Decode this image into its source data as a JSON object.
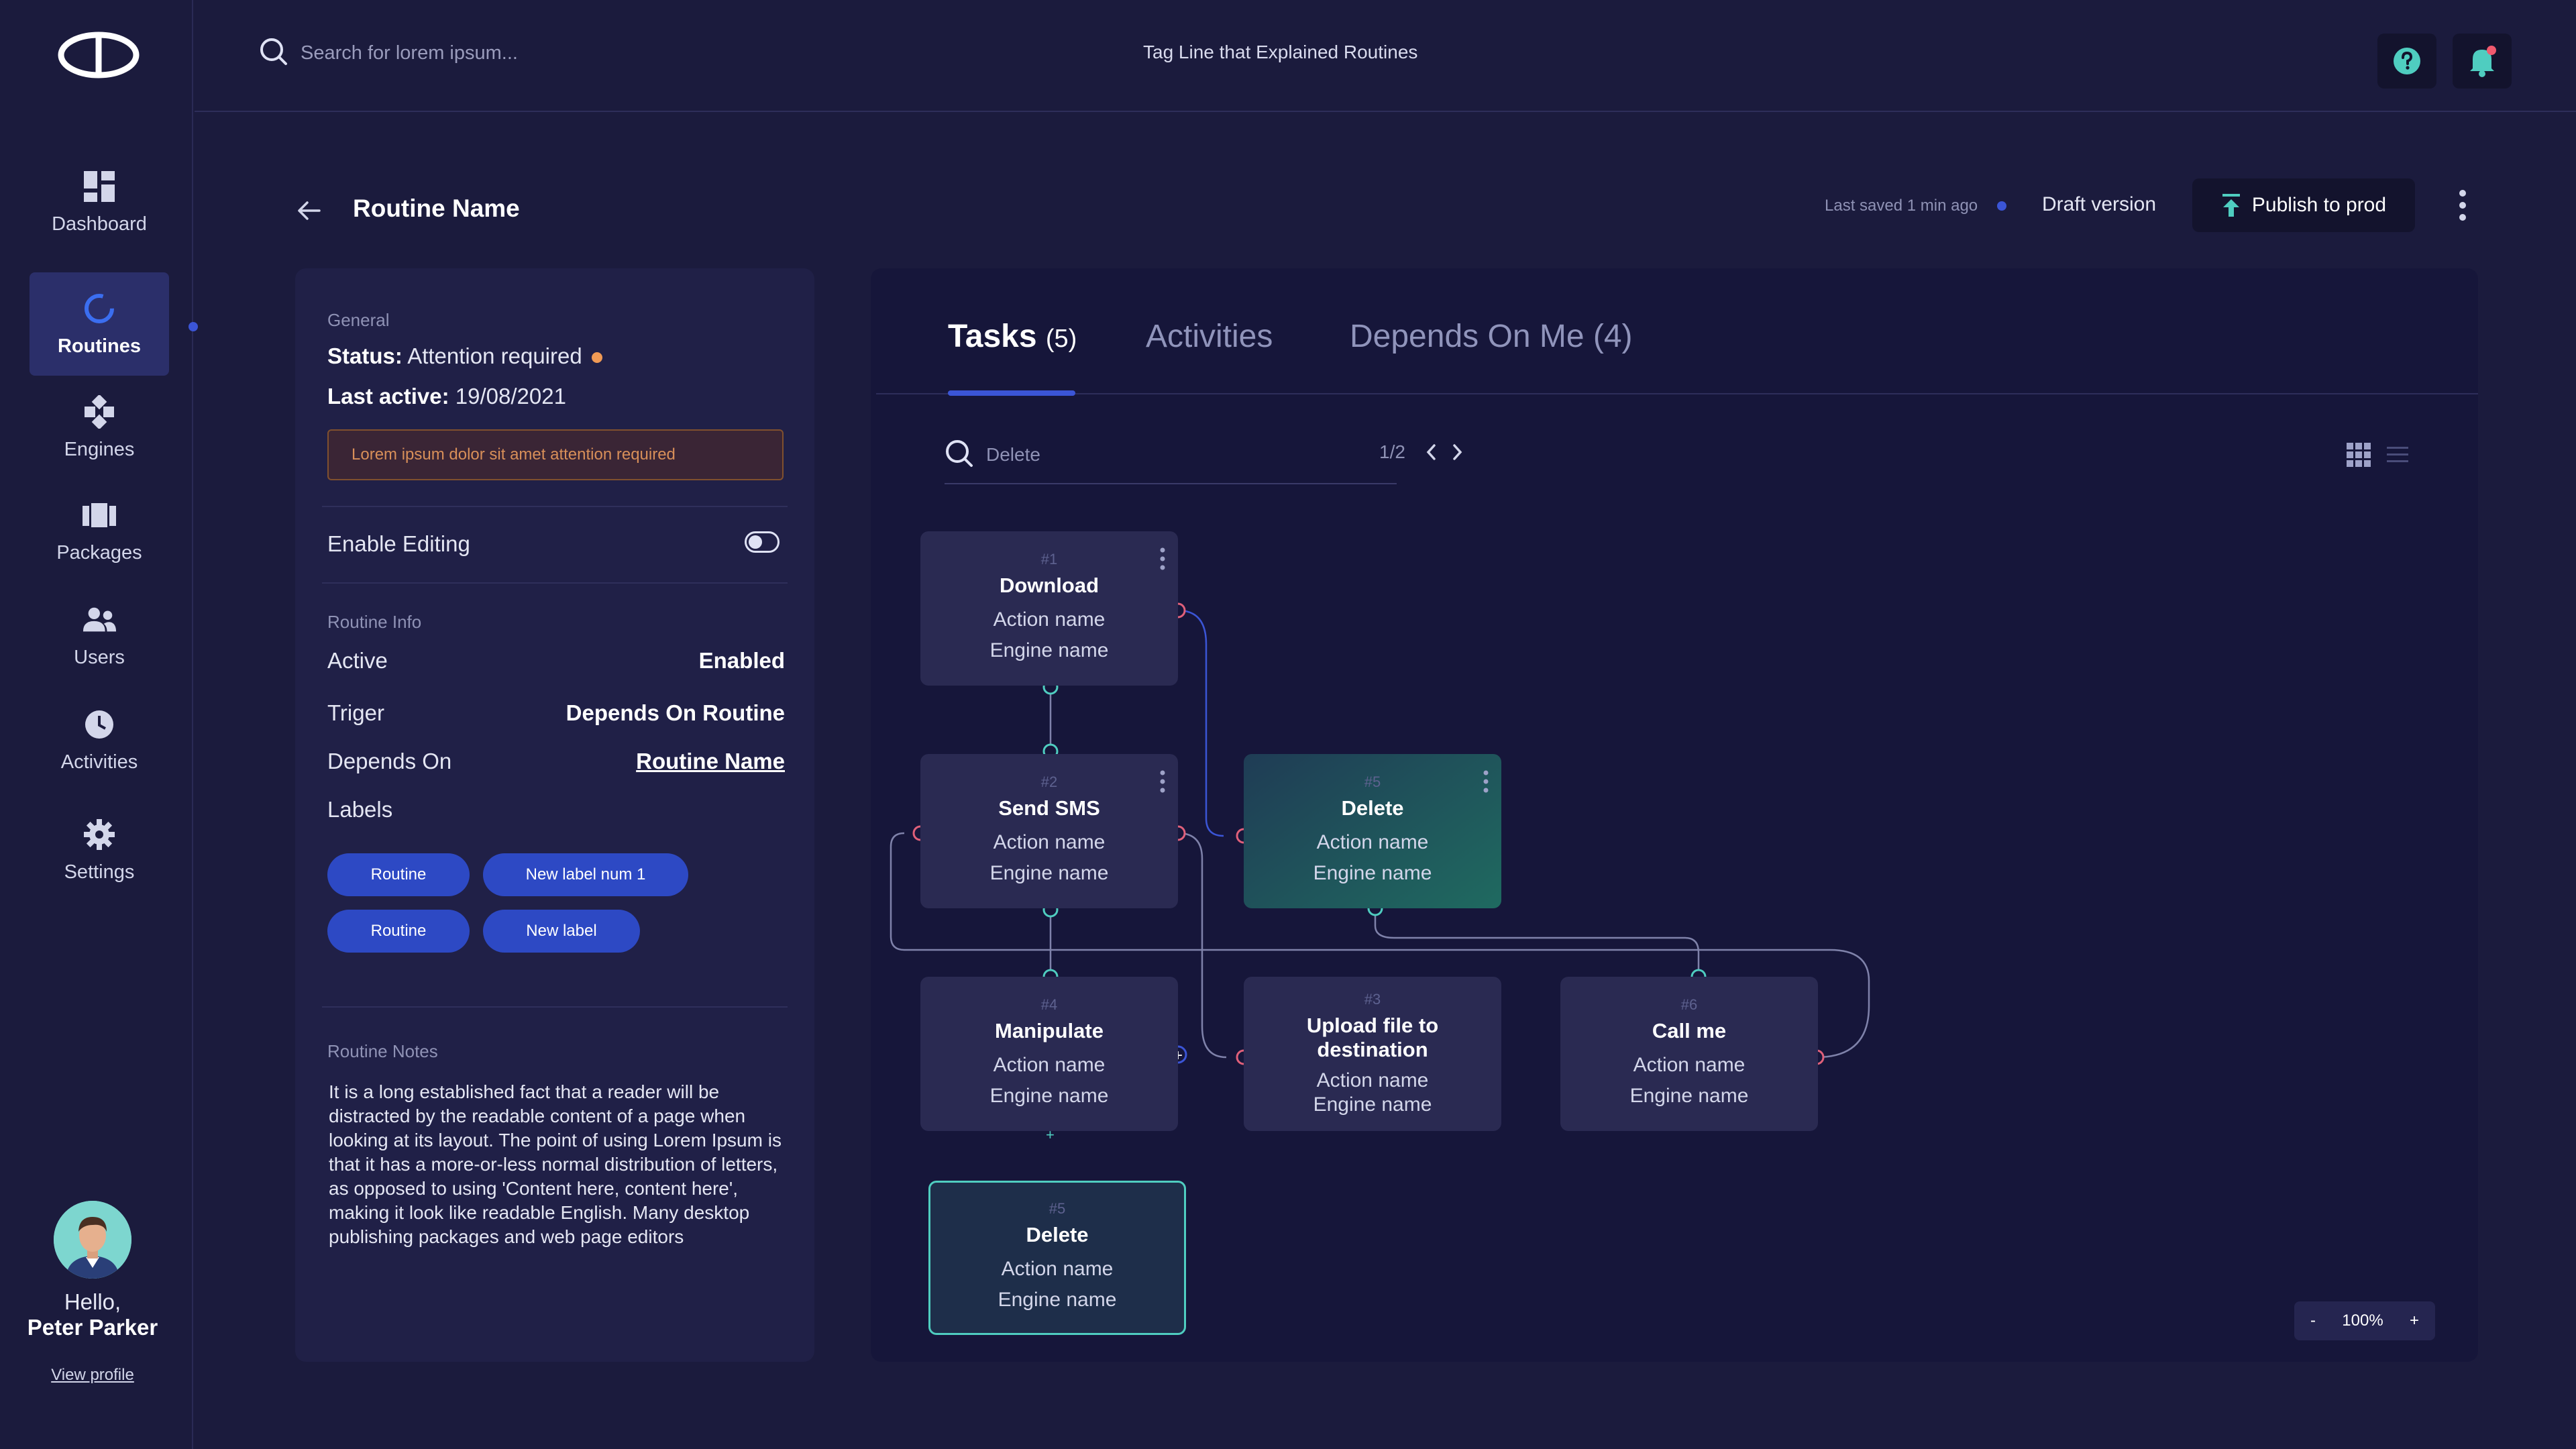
{
  "sidebar": {
    "items": [
      {
        "label": "Dashboard",
        "icon": "dashboard-icon"
      },
      {
        "label": "Routines",
        "icon": "routines-icon",
        "active": true
      },
      {
        "label": "Engines",
        "icon": "engines-icon"
      },
      {
        "label": "Packages",
        "icon": "packages-icon"
      },
      {
        "label": "Users",
        "icon": "users-icon"
      },
      {
        "label": "Activities",
        "icon": "activities-icon"
      },
      {
        "label": "Settings",
        "icon": "settings-icon"
      }
    ],
    "greeting": "Hello,",
    "user_name": "Peter Parker",
    "view_profile": "View profile"
  },
  "topbar": {
    "search_placeholder": "Search for lorem ipsum...",
    "tagline": "Tag Line that Explained Routines"
  },
  "header": {
    "title": "Routine Name",
    "last_saved": "Last saved 1 min ago",
    "draft": "Draft version",
    "publish": "Publish to prod"
  },
  "general": {
    "section": "General",
    "status_key": "Status:",
    "status_value": "Attention required",
    "last_active_key": "Last active:",
    "last_active_value": "19/08/2021",
    "alert": "Lorem ipsum dolor sit amet attention required",
    "enable_editing": "Enable Editing"
  },
  "routine_info": {
    "section": "Routine Info",
    "rows": [
      {
        "key": "Active",
        "value": "Enabled"
      },
      {
        "key": "Triger",
        "value": "Depends On Routine"
      },
      {
        "key": "Depends On",
        "value": "Routine Name"
      }
    ],
    "labels_title": "Labels",
    "labels": [
      "Routine",
      "New label num 1",
      "Routine",
      "New label"
    ]
  },
  "notes": {
    "section": "Routine Notes",
    "text": "It is a long established fact that a reader will be distracted by the readable content of a page when looking at its layout. The point of using Lorem Ipsum is that it has a more-or-less normal distribution of letters, as opposed to using 'Content here, content here', making it look like readable English. Many desktop publishing packages and web page editors"
  },
  "tabs": [
    {
      "label": "Tasks",
      "count": "(5)",
      "active": true
    },
    {
      "label": "Activities"
    },
    {
      "label": "Depends On Me (4)"
    }
  ],
  "flow_search": {
    "placeholder": "Delete",
    "pager": "1/2"
  },
  "nodes": [
    {
      "num": "#1",
      "title": "Download",
      "action": "Action name",
      "engine": "Engine name"
    },
    {
      "num": "#2",
      "title": "Send SMS",
      "action": "Action name",
      "engine": "Engine name"
    },
    {
      "num": "#5",
      "title": "Delete",
      "action": "Action name",
      "engine": "Engine name"
    },
    {
      "num": "#4",
      "title": "Manipulate",
      "action": "Action name",
      "engine": "Engine name"
    },
    {
      "num": "#3",
      "title": "Upload file to destination",
      "action": "Action name",
      "engine": "Engine name"
    },
    {
      "num": "#6",
      "title": "Call me",
      "action": "Action name",
      "engine": "Engine name"
    },
    {
      "num": "#5",
      "title": "Delete",
      "action": "Action name",
      "engine": "Engine name"
    }
  ],
  "zoom": {
    "minus": "-",
    "level": "100%",
    "plus": "+"
  },
  "colors": {
    "background": "#1b1b3d",
    "panel": "#202047",
    "accent": "#3b55d6",
    "warning": "#f09a55",
    "port_out": "#e0607a",
    "port_in": "#4fcdc0"
  }
}
